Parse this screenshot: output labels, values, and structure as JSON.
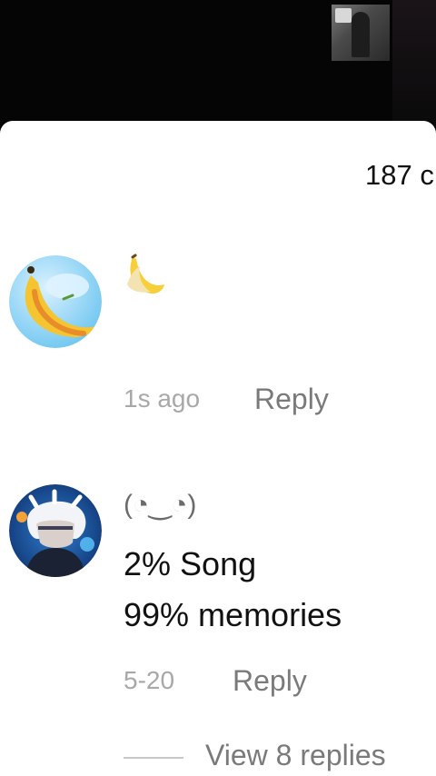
{
  "comments_header": {
    "count_text": "187 c"
  },
  "comments": [
    {
      "avatar": "banana-avatar",
      "content_icon": "banana-emoji-icon",
      "time": "1s ago",
      "reply_label": "Reply"
    },
    {
      "avatar": "anime-character-avatar",
      "username": "(◔‿◔)",
      "lines": [
        "2% Song",
        "99% memories"
      ],
      "time": "5-20",
      "reply_label": "Reply",
      "view_replies_label": "View 8 replies"
    }
  ]
}
